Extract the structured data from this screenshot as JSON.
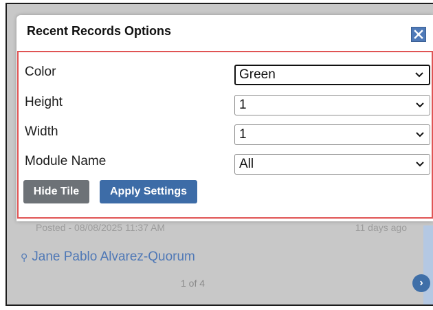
{
  "dialog": {
    "title": "Recent Records Options",
    "close_icon": "close-icon"
  },
  "fields": [
    {
      "label": "Color",
      "value": "Green"
    },
    {
      "label": "Height",
      "value": "1"
    },
    {
      "label": "Width",
      "value": "1"
    },
    {
      "label": "Module Name",
      "value": "All"
    }
  ],
  "buttons": {
    "hide_tile": "Hide Tile",
    "apply_settings": "Apply Settings"
  },
  "background_tile": {
    "posted": "Posted - 08/08/2025 11:37 AM",
    "age": "11 days ago",
    "contact_name": "Jane Pablo Alvarez-Quorum",
    "pager": "1 of 4",
    "next_icon": "chevron-right-circle-icon"
  },
  "colors": {
    "accent": "#3d6ca7",
    "hide_button": "#6d7277",
    "highlight_border": "#e05454",
    "overlay": "#c8c8c8"
  }
}
